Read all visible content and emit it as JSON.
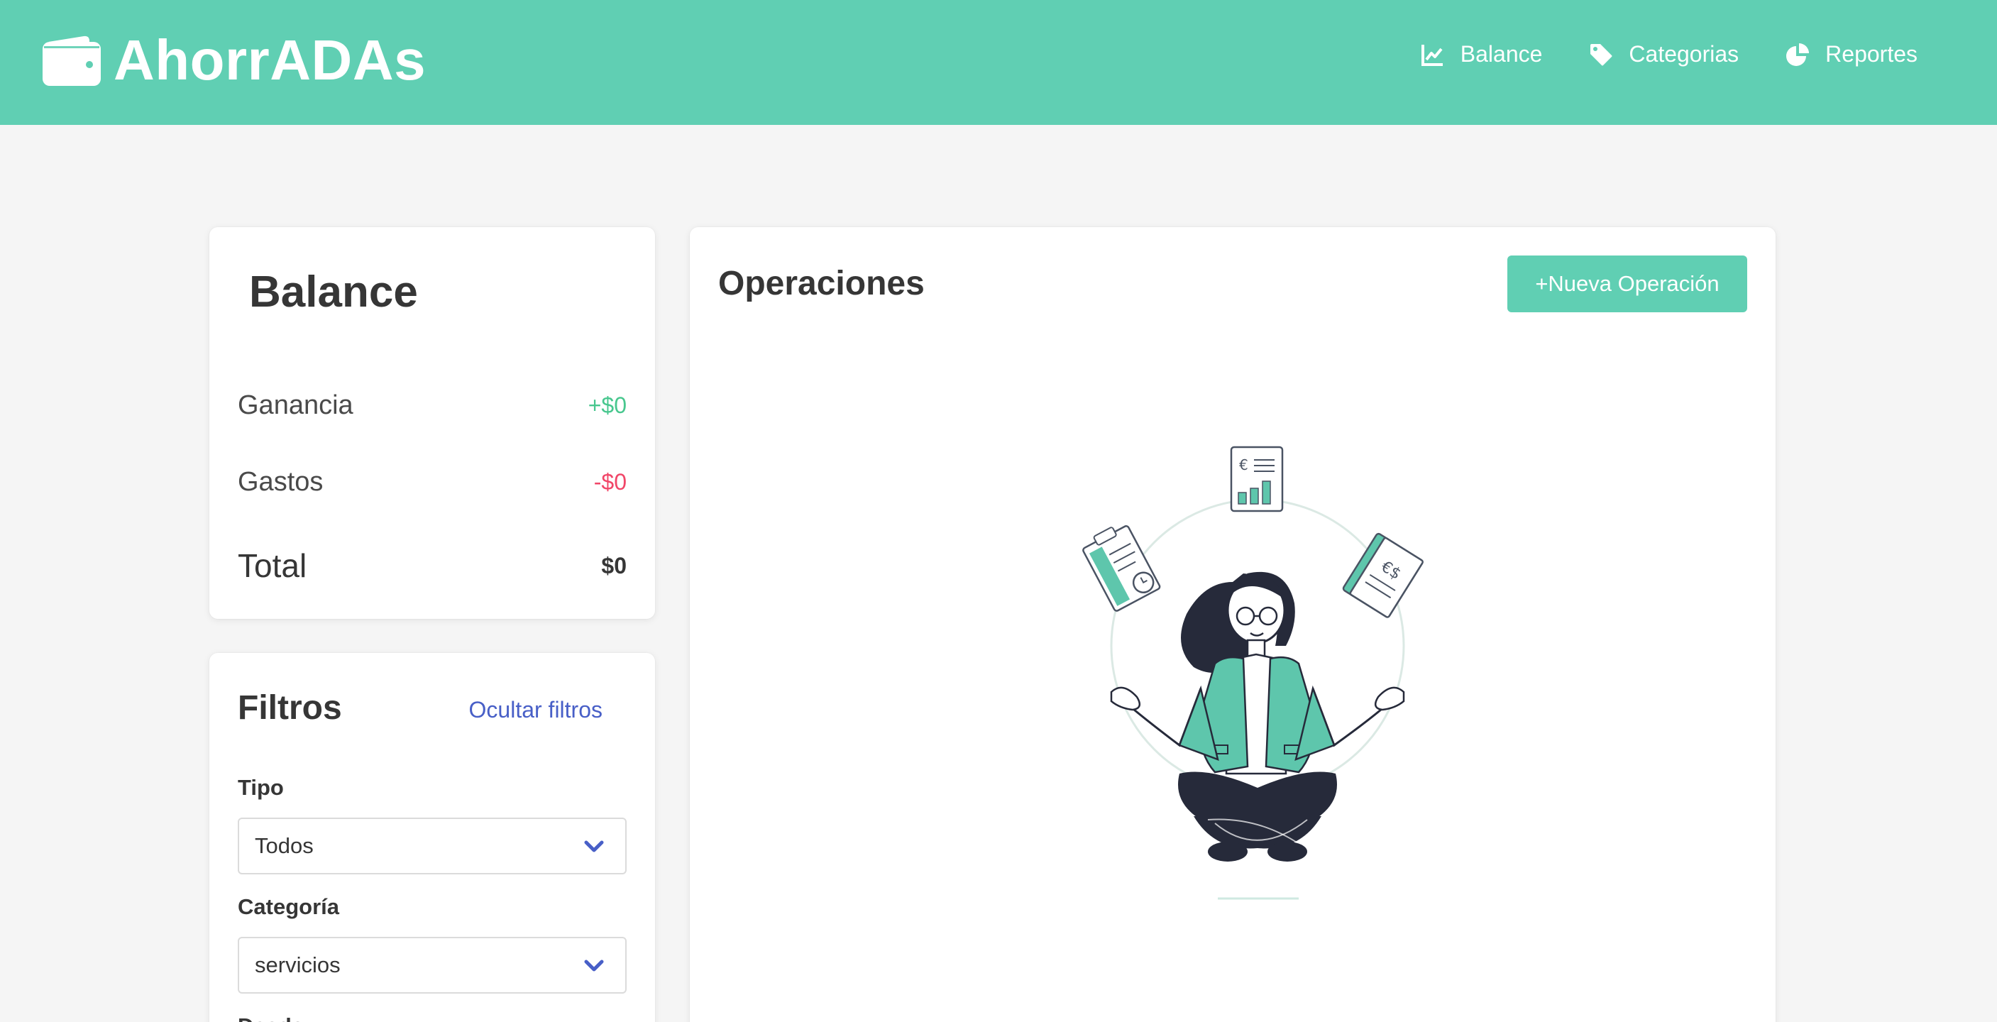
{
  "header": {
    "brand": "AhorrADAs",
    "brand_icon": "wallet-icon",
    "nav": [
      {
        "label": "Balance",
        "icon": "chart-line-icon"
      },
      {
        "label": "Categorias",
        "icon": "tag-icon"
      },
      {
        "label": "Reportes",
        "icon": "pie-chart-icon"
      }
    ],
    "color": "#60cfb3"
  },
  "balance": {
    "title": "Balance",
    "rows": [
      {
        "label": "Ganancia",
        "value": "+$0",
        "color": "#48c78e"
      },
      {
        "label": "Gastos",
        "value": "-$0",
        "color": "#f14668"
      },
      {
        "label": "Total",
        "value": "$0"
      }
    ]
  },
  "filters": {
    "title": "Filtros",
    "toggle_label": "Ocultar filtros",
    "fields": [
      {
        "label": "Tipo",
        "value": "Todos"
      },
      {
        "label": "Categoría",
        "value": "servicios"
      },
      {
        "label": "Desde",
        "value": ""
      }
    ]
  },
  "operations": {
    "title": "Operaciones",
    "new_button": "+Nueva Operación",
    "empty_illustration": "meditating-woman-with-finance-documents"
  },
  "colors": {
    "accent": "#60cfb3",
    "link": "#485fc7",
    "positive": "#48c78e",
    "negative": "#f14668",
    "background": "#f5f5f5"
  }
}
